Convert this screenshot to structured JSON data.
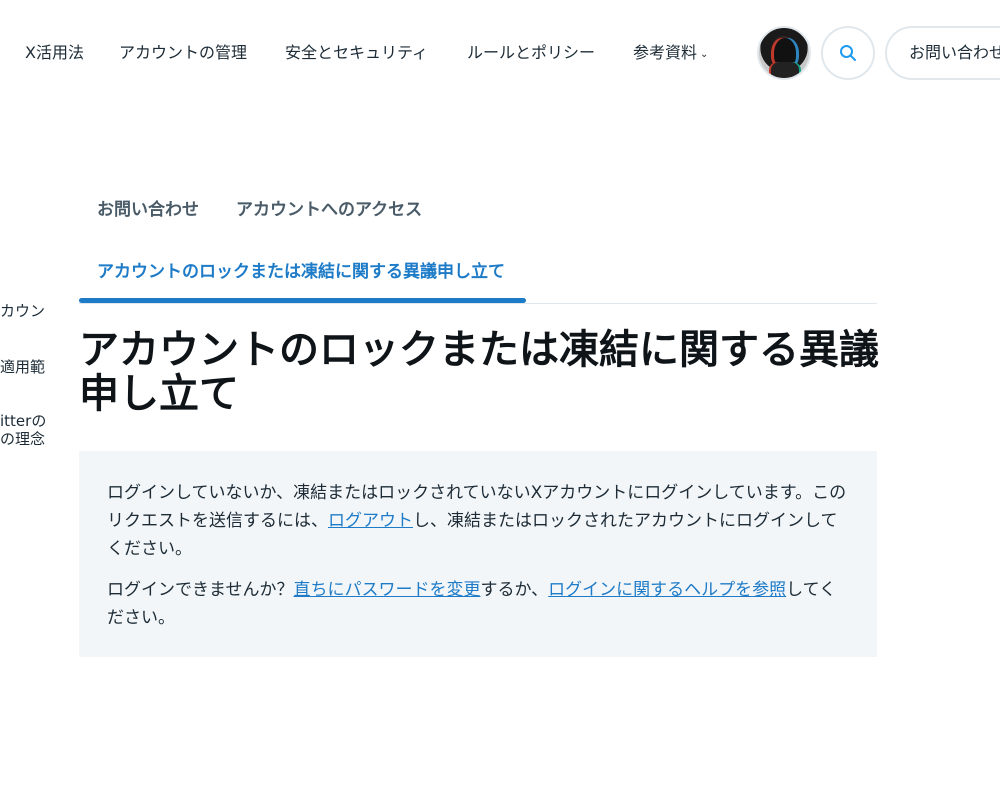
{
  "nav": {
    "items": [
      {
        "label": "X活用法"
      },
      {
        "label": "アカウントの管理"
      },
      {
        "label": "安全とセキュリティ"
      },
      {
        "label": "ルールとポリシー"
      },
      {
        "label": "参考資料"
      }
    ],
    "chevron": "⌄",
    "contact_label": "お問い合わせ"
  },
  "sidebar": {
    "items": [
      {
        "label": "カウン"
      },
      {
        "label": "適用範"
      },
      {
        "label": "itterの"
      },
      {
        "label": "の理念"
      }
    ]
  },
  "tabs": [
    {
      "label": "お問い合わせ"
    },
    {
      "label": "アカウントへのアクセス"
    },
    {
      "label": "アカウントのロックまたは凍結に関する異議申し立て"
    }
  ],
  "page": {
    "title": "アカウントのロックまたは凍結に関する異議申し立て"
  },
  "notice": {
    "p1_a": "ログインしていないか、凍結またはロックされていないXアカウントにログインしています。このリクエストを送信するには、",
    "p1_link": "ログアウト",
    "p1_b": "し、凍結またはロックされたアカウントにログインしてください。",
    "p2_a": "ログインできませんか？",
    "p2_link1": "直ちにパスワードを変更",
    "p2_b": "するか、",
    "p2_link2": "ログインに関するヘルプを参照",
    "p2_c": "してください。"
  },
  "colors": {
    "accent": "#1d7bc8",
    "notice_bg": "#f3f6f8",
    "search_icon": "#1d9bf0"
  },
  "icons": {
    "search": "search-icon",
    "chevron": "chevron-down-icon"
  }
}
